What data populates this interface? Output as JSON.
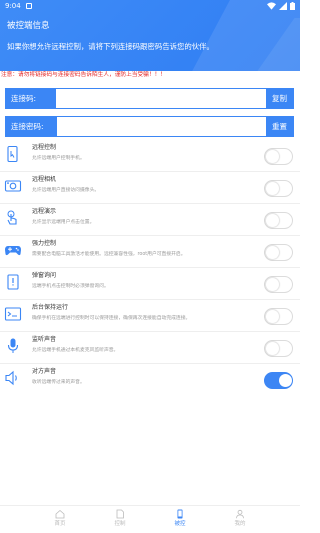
{
  "status_bar": {
    "time": "9:04"
  },
  "header": {
    "title": "被控端信息",
    "subtitle": "如果你想允许远程控制，请将下列连接码跟密码告诉您的伙伴。"
  },
  "notice": "注意：请勿将链接码与连接密码告诉陌生人，谨防上当受骗！！！",
  "connection": {
    "code_label": "连接码:",
    "code_value": "",
    "copy_label": "复制",
    "password_label": "连接密码:",
    "password_value": "",
    "reset_label": "重置"
  },
  "features": [
    {
      "name": "远程控制",
      "desc": "允许远端用户控制手机。",
      "icon": "phone-control-icon",
      "enabled": false
    },
    {
      "name": "远程相机",
      "desc": "允许远端用户直接访问摄像头。",
      "icon": "camera-icon",
      "enabled": false
    },
    {
      "name": "远程演示",
      "desc": "允许显示远端用户点击位置。",
      "icon": "touch-icon",
      "enabled": false
    },
    {
      "name": "强力控制",
      "desc": "需要配合电脑工具激活才能使用。远控兼容性强，root用户可直接开启。",
      "icon": "gamepad-icon",
      "enabled": false
    },
    {
      "name": "弹窗询问",
      "desc": "远端手机点击控制时必须弹窗询问。",
      "icon": "popup-icon",
      "enabled": false
    },
    {
      "name": "后台保持运行",
      "desc": "确保手机在远端进行控制时可以保持连接，确保再次连接能自动完成连接。",
      "icon": "terminal-icon",
      "enabled": false
    },
    {
      "name": "监听声音",
      "desc": "允许远端手机通过本机麦克风监听声音。",
      "icon": "microphone-icon",
      "enabled": false
    },
    {
      "name": "对方声音",
      "desc": "收听远端传过来的声音。",
      "icon": "speaker-icon",
      "enabled": true
    }
  ],
  "tabs": [
    {
      "label": "首页",
      "icon": "home-icon",
      "active": false
    },
    {
      "label": "控制",
      "icon": "file-icon",
      "active": false
    },
    {
      "label": "被控",
      "icon": "mobile-icon",
      "active": true
    },
    {
      "label": "我的",
      "icon": "user-icon",
      "active": false
    }
  ],
  "colors": {
    "primary": "#3b86f5",
    "notice": "#e32424"
  }
}
